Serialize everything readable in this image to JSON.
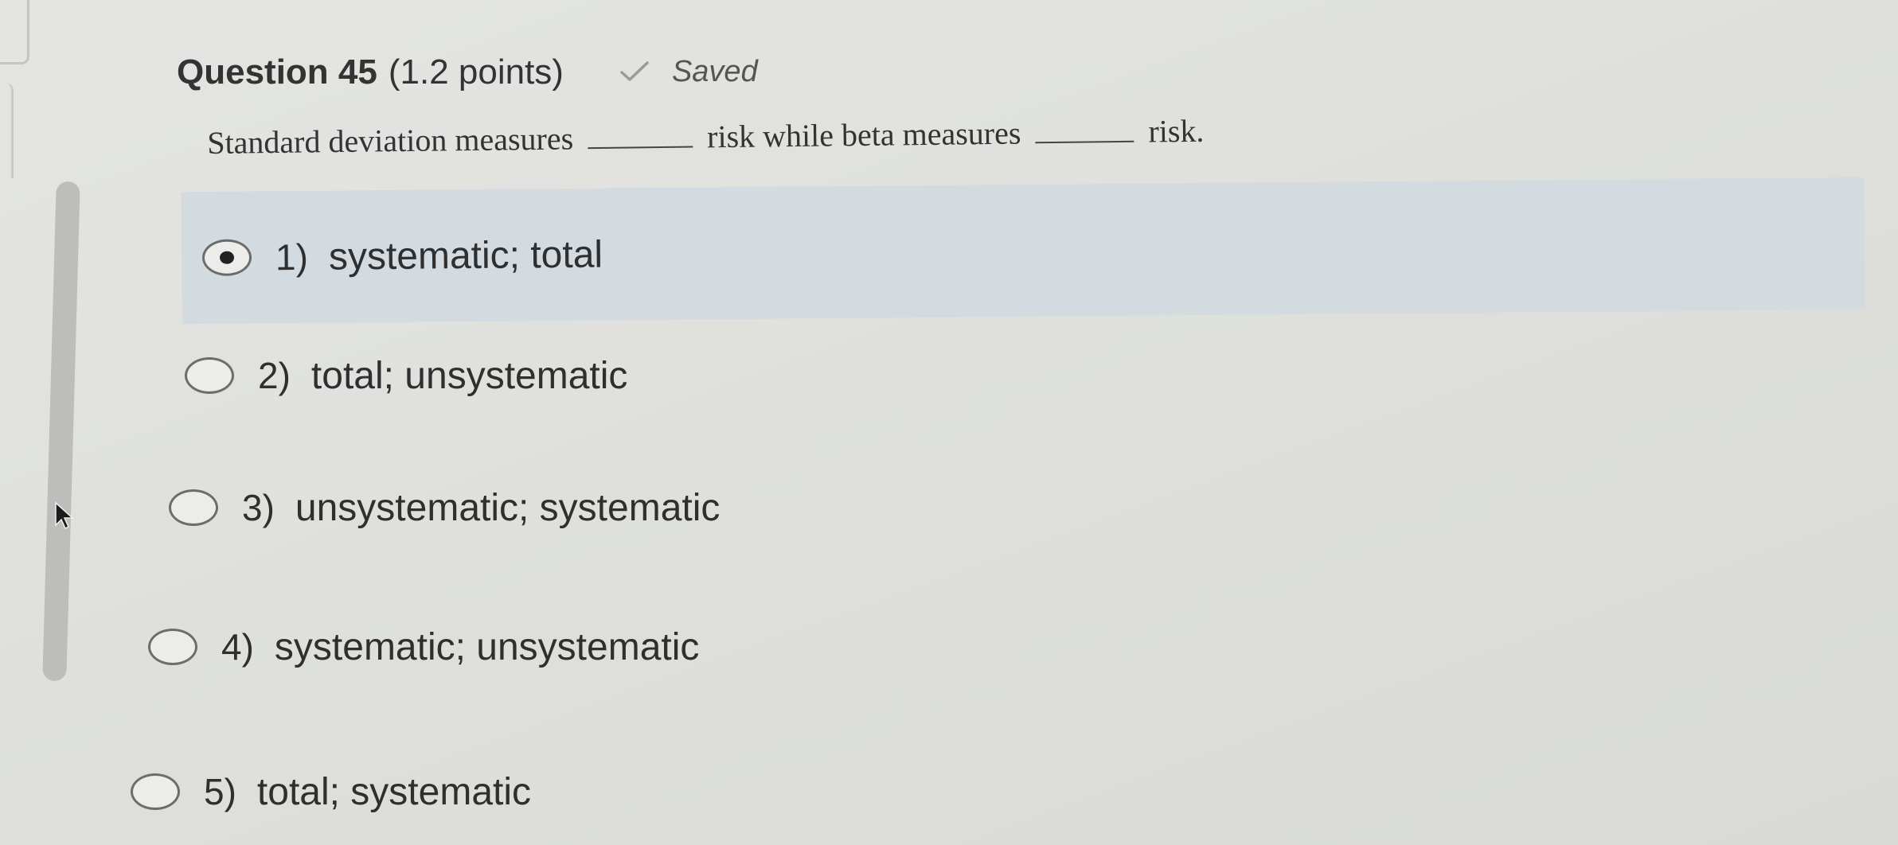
{
  "question": {
    "title": "Question 45",
    "points": "(1.2 points)",
    "status": "Saved",
    "status_icon": "checkmark-icon",
    "stem_part1": "Standard deviation measures",
    "stem_part2": "risk while beta measures",
    "stem_part3": "risk."
  },
  "options": [
    {
      "number": "1)",
      "label": "systematic; total",
      "selected": true
    },
    {
      "number": "2)",
      "label": "total; unsystematic",
      "selected": false
    },
    {
      "number": "3)",
      "label": "unsystematic; systematic",
      "selected": false
    },
    {
      "number": "4)",
      "label": "systematic; unsystematic",
      "selected": false
    },
    {
      "number": "5)",
      "label": "total; systematic",
      "selected": false
    }
  ],
  "colors": {
    "selected_highlight": "#d3dbe1",
    "background": "#e1e2de"
  }
}
